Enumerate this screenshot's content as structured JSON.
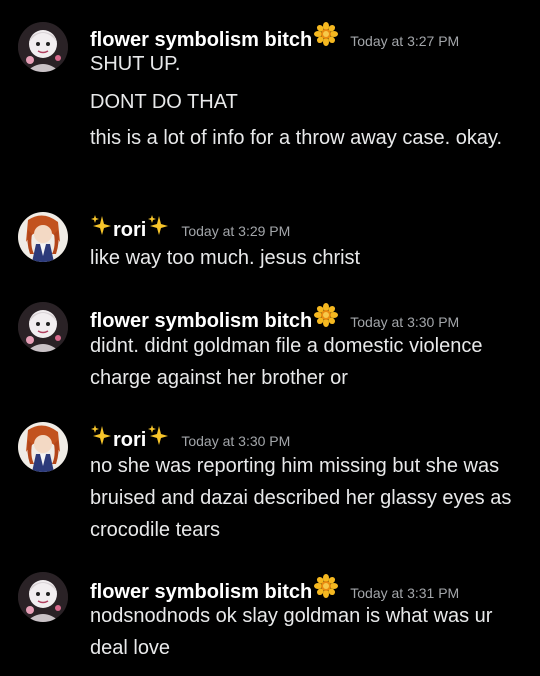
{
  "messages": [
    {
      "username": "flower symbolism bitch",
      "badge_icon": "sunflower-emoji",
      "timestamp": "Today at 3:27 PM",
      "lines": [
        "SHUT UP.",
        "DONT DO THAT",
        "this is a lot of info for a throw away case. okay."
      ]
    },
    {
      "username_prefix_icon": "sparkles-emoji",
      "username": "rori",
      "username_suffix_icon": "sparkles-emoji",
      "timestamp": "Today at 3:29 PM",
      "lines": [
        "like way too much. jesus christ"
      ]
    },
    {
      "username": "flower symbolism bitch",
      "badge_icon": "sunflower-emoji",
      "timestamp": "Today at 3:30 PM",
      "lines": [
        "didnt. didnt goldman file a domestic violence charge against her brother or"
      ]
    },
    {
      "username_prefix_icon": "sparkles-emoji",
      "username": "rori",
      "username_suffix_icon": "sparkles-emoji",
      "timestamp": "Today at 3:30 PM",
      "lines": [
        "no she was reporting him missing but she was bruised and dazai described her glassy eyes as crocodile tears"
      ]
    },
    {
      "username": "flower symbolism bitch",
      "badge_icon": "sunflower-emoji",
      "timestamp": "Today at 3:31 PM",
      "lines": [
        "nodsnodnods ok slay goldman is what was ur deal love"
      ]
    }
  ],
  "colors": {
    "background": "#000000",
    "username": "#ffffff",
    "timestamp": "#a3a6aa",
    "text": "#e8e9ea"
  }
}
